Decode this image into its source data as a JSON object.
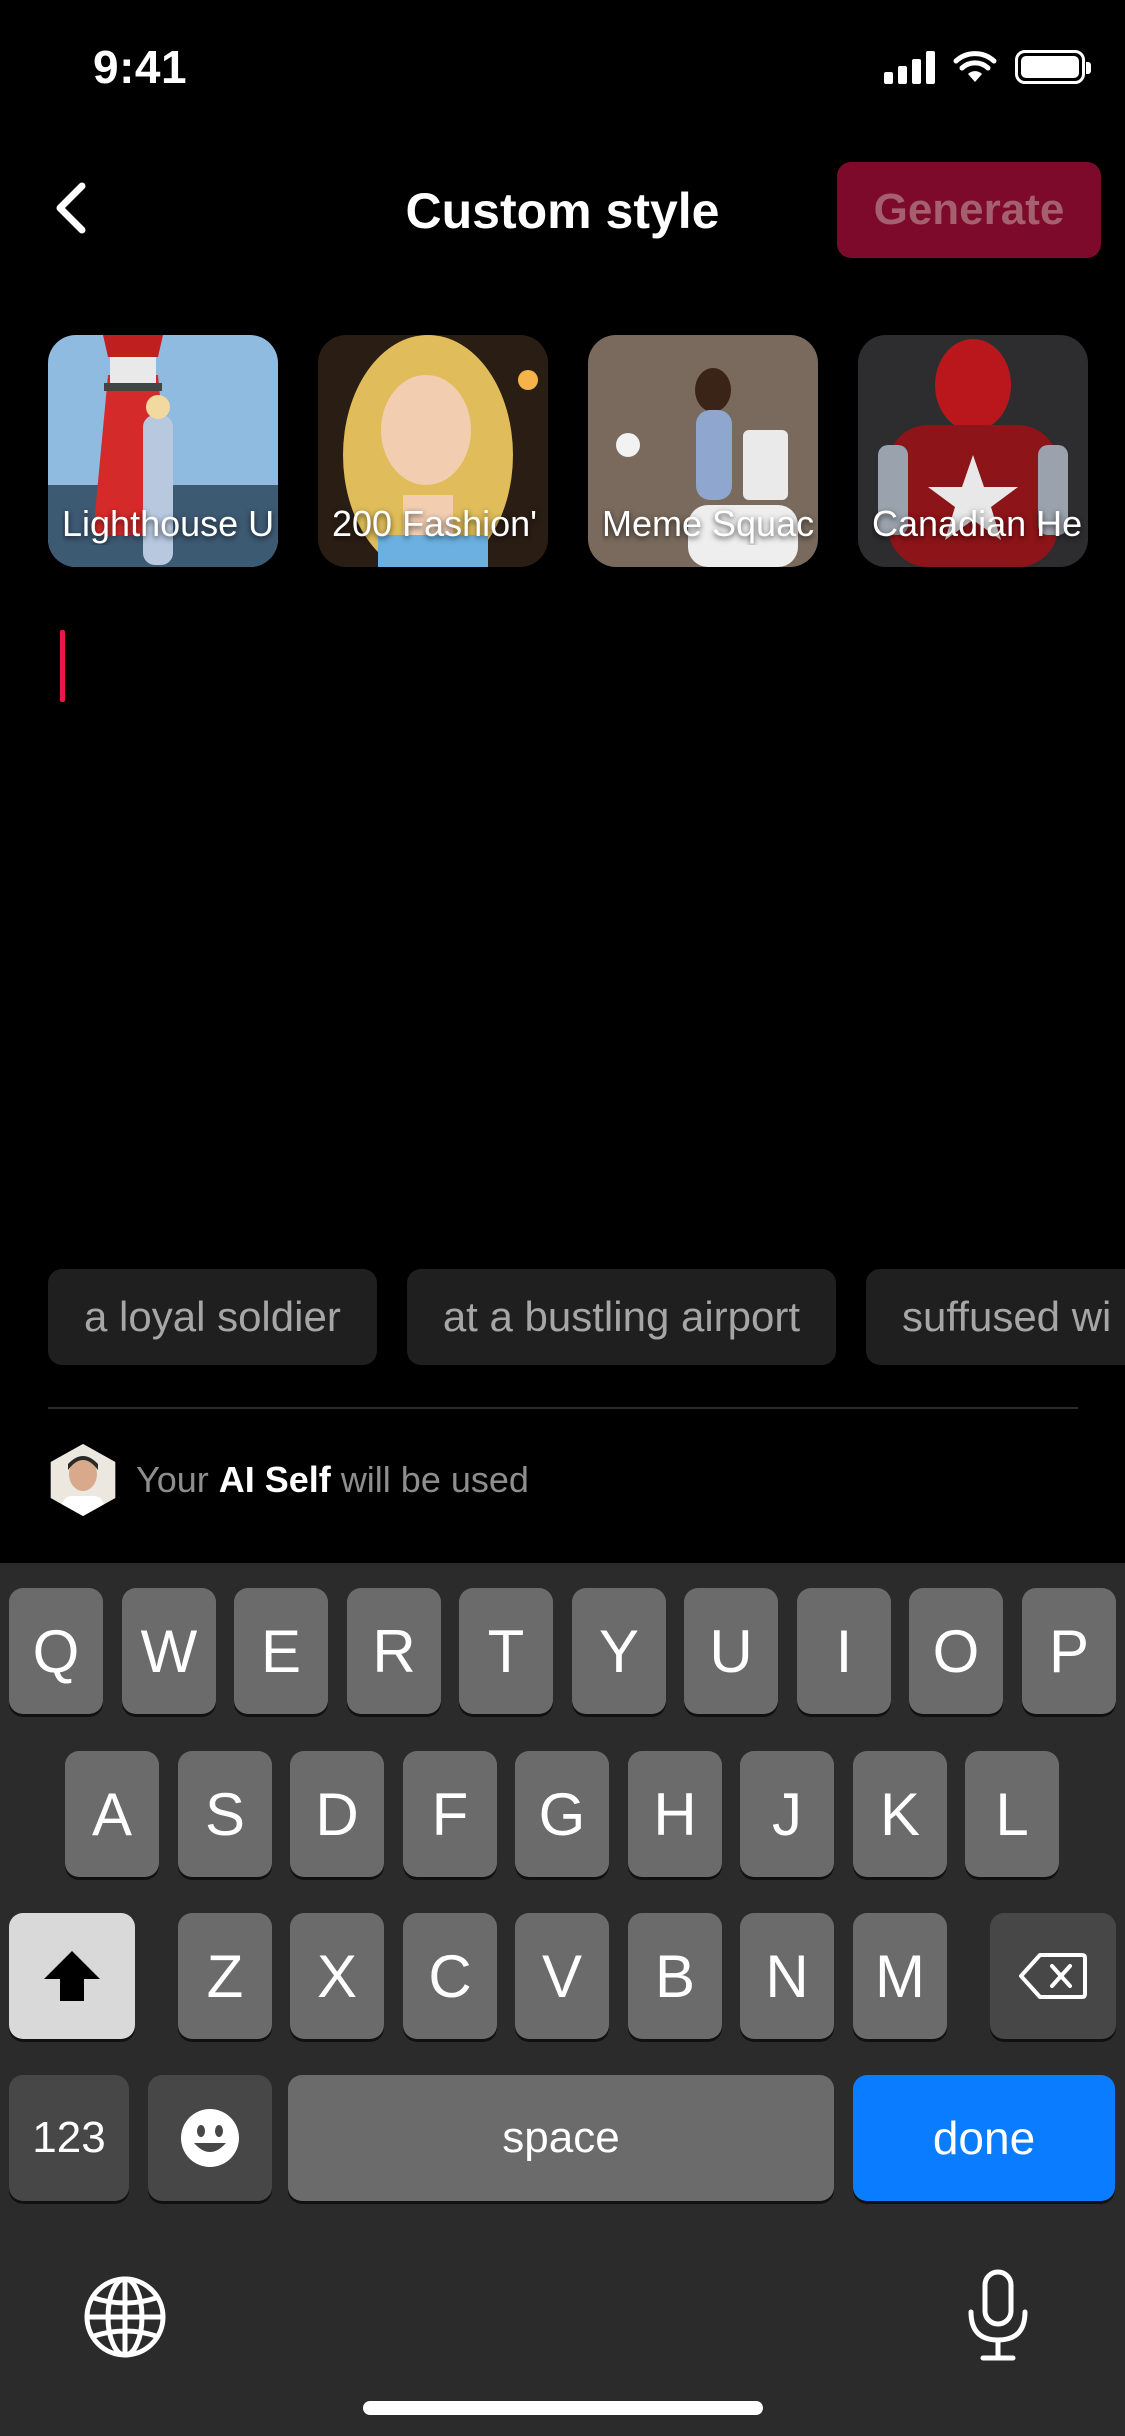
{
  "status_bar": {
    "time": "9:41"
  },
  "header": {
    "title": "Custom style",
    "generate_label": "Generate"
  },
  "style_cards": [
    {
      "label": "Lighthouse U"
    },
    {
      "label": "200 Fashion'"
    },
    {
      "label": "Meme Squac"
    },
    {
      "label": "Canadian He"
    }
  ],
  "suggestions": [
    "a loyal soldier",
    "at a bustling airport",
    "suffused wi"
  ],
  "ai_self": {
    "prefix": "Your",
    "highlight": "AI Self",
    "suffix": "will be used"
  },
  "keyboard": {
    "row1": [
      "Q",
      "W",
      "E",
      "R",
      "T",
      "Y",
      "U",
      "I",
      "O",
      "P"
    ],
    "row2": [
      "A",
      "S",
      "D",
      "F",
      "G",
      "H",
      "J",
      "K",
      "L"
    ],
    "row3": [
      "Z",
      "X",
      "C",
      "V",
      "B",
      "N",
      "M"
    ],
    "numbers_label": "123",
    "space_label": "space",
    "done_label": "done"
  },
  "colors": {
    "accent": "#e8184b",
    "generate_disabled_bg": "#7d0a2a",
    "done_blue": "#0a7cff"
  }
}
